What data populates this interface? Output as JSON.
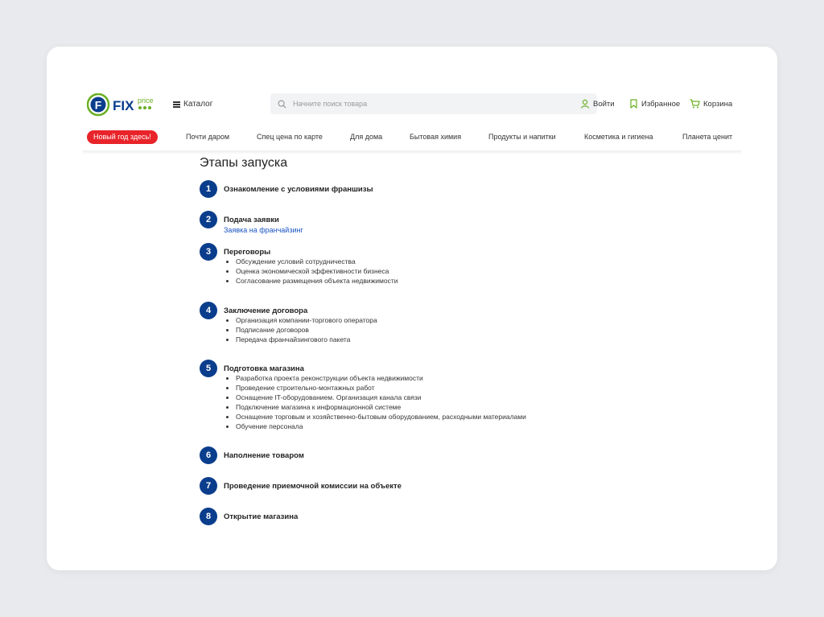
{
  "header": {
    "logo_text": "FIX price",
    "catalog_label": "Каталог",
    "search_placeholder": "Начните поиск товара",
    "login_label": "Войти",
    "favorites_label": "Избранное",
    "cart_label": "Корзина"
  },
  "nav": {
    "promo_label": "Новый год здесь!",
    "items": [
      "Почти даром",
      "Спец цена по карте",
      "Для дома",
      "Бытовая химия",
      "Продукты и напитки",
      "Косметика и гигиена",
      "Планета ценит"
    ]
  },
  "colors": {
    "brand_green": "#6ab023",
    "brand_blue": "#0a3d8c",
    "promo_red": "#e8242a",
    "link_blue": "#1a55c4"
  },
  "page": {
    "title": "Этапы запуска",
    "steps": [
      {
        "num": "1",
        "title": "Ознакомление с условиями франшизы"
      },
      {
        "num": "2",
        "title": "Подача заявки",
        "link": "Заявка на франчайзинг"
      },
      {
        "num": "3",
        "title": "Переговоры",
        "bullets": [
          "Обсуждение условий сотрудничества",
          "Оценка экономической эффективности бизнеса",
          "Согласование размещения объекта недвижимости"
        ]
      },
      {
        "num": "4",
        "title": "Заключение договора",
        "bullets": [
          "Организация компании-торгового оператора",
          "Подписание договоров",
          "Передача франчайзингового пакета"
        ]
      },
      {
        "num": "5",
        "title": "Подготовка магазина",
        "bullets": [
          "Разработка проекта реконструкции объекта недвижимости",
          "Проведение строительно-монтажных работ",
          "Оснащение IT-оборудованием. Организация канала связи",
          "Подключение магазина к информационной системе",
          "Оснащение торговым и хозяйственно-бытовым оборудованием, расходными материалами",
          "Обучение персонала"
        ]
      },
      {
        "num": "6",
        "title": "Наполнение товаром"
      },
      {
        "num": "7",
        "title": "Проведение приемочной комиссии на объекте"
      },
      {
        "num": "8",
        "title": "Открытие магазина"
      }
    ]
  }
}
